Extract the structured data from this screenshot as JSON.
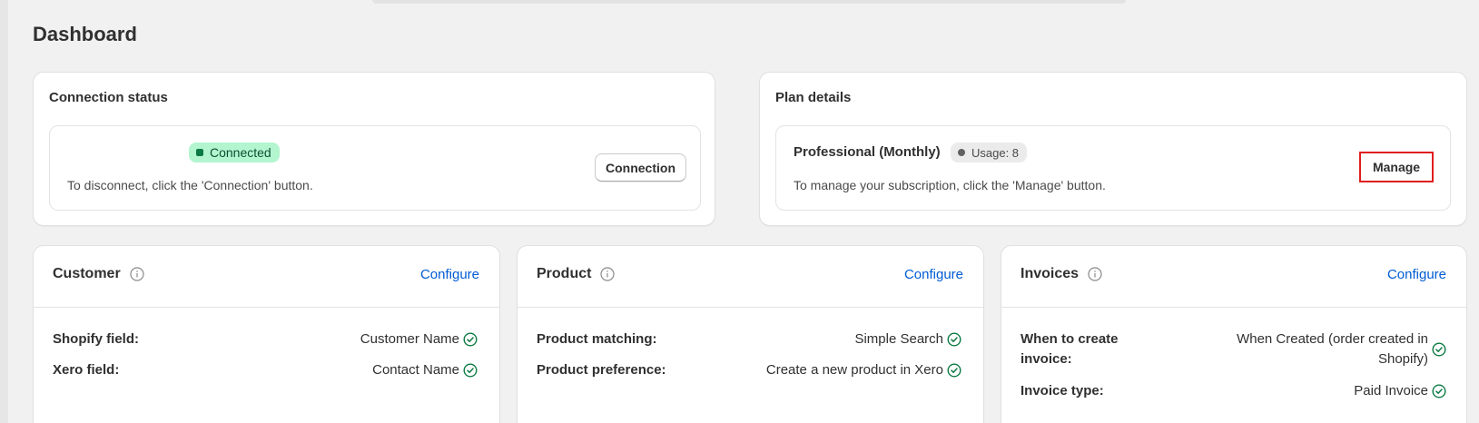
{
  "page": {
    "title": "Dashboard"
  },
  "connection": {
    "title": "Connection status",
    "status_label": "Connected",
    "hint": "To disconnect, click the 'Connection' button.",
    "button_label": "Connection"
  },
  "plan": {
    "title": "Plan details",
    "plan_name": "Professional (Monthly)",
    "usage_label": "Usage: 8",
    "hint": "To manage your subscription, click the 'Manage' button.",
    "button_label": "Manage"
  },
  "customer": {
    "title": "Customer",
    "configure_label": "Configure",
    "rows": [
      {
        "label": "Shopify field:",
        "value": "Customer Name"
      },
      {
        "label": "Xero field:",
        "value": "Contact Name"
      }
    ]
  },
  "product": {
    "title": "Product",
    "configure_label": "Configure",
    "rows": [
      {
        "label": "Product matching:",
        "value": "Simple Search"
      },
      {
        "label": "Product preference:",
        "value": "Create a new product in Xero"
      }
    ]
  },
  "invoices": {
    "title": "Invoices",
    "configure_label": "Configure",
    "rows": [
      {
        "label": "When to create invoice:",
        "value_line1": "When Created (order created in",
        "value_line2": "Shopify)"
      },
      {
        "label": "Invoice type:",
        "value": "Paid Invoice"
      }
    ]
  },
  "colors": {
    "accent_link": "#005bd3",
    "connected_bg": "#b2f5cf",
    "connected_text": "#0c5132",
    "check_green": "#0c7a43",
    "highlight_red": "#e01e1e"
  }
}
